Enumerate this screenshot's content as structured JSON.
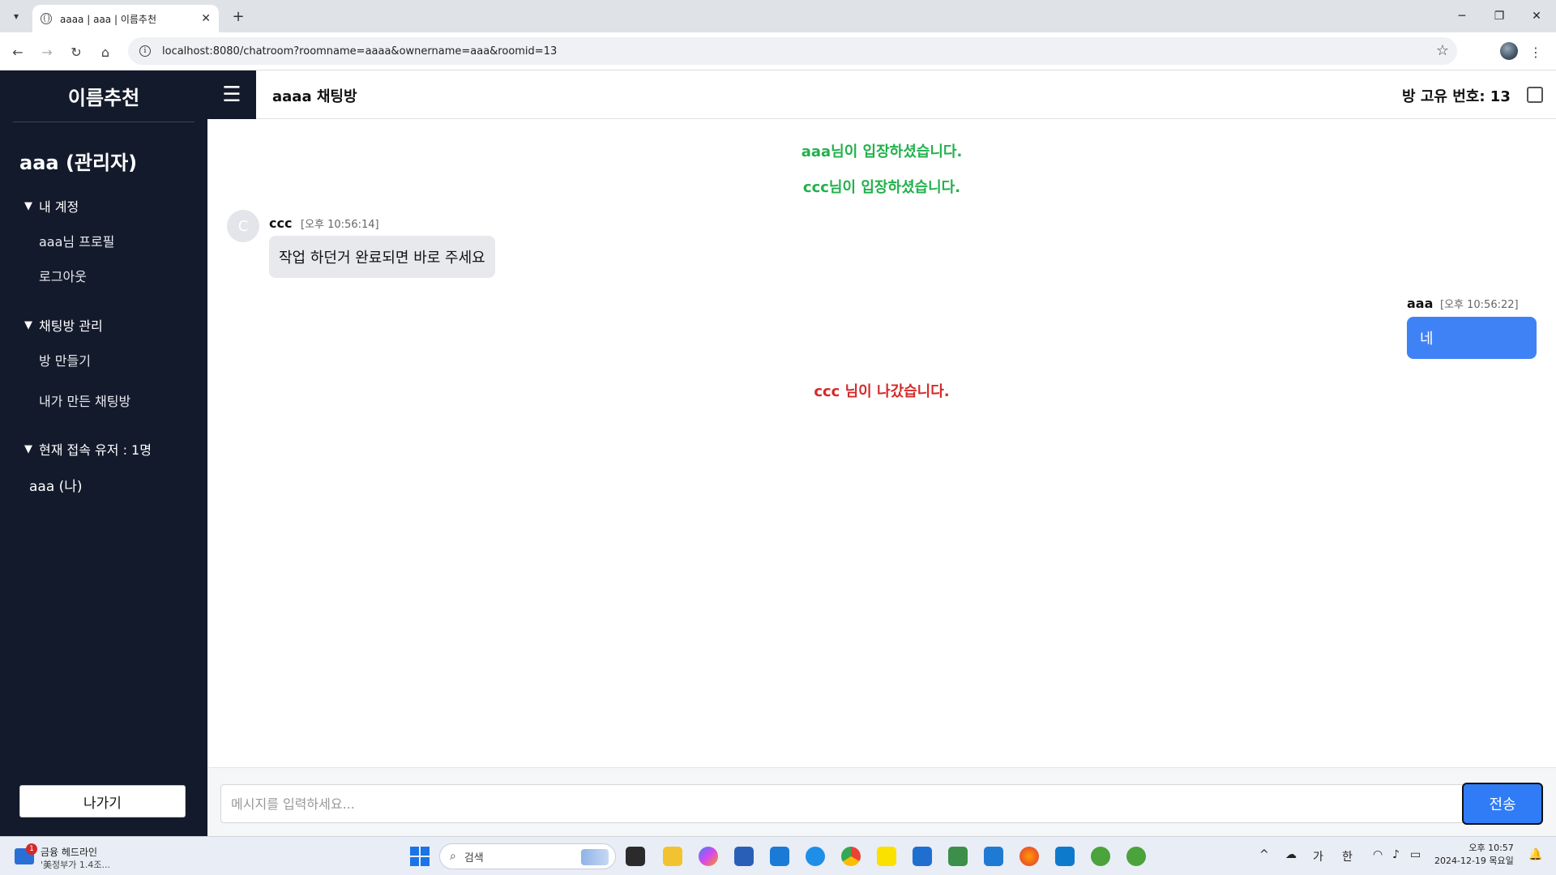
{
  "browser": {
    "tab_title": "aaaa | aaa | 이름추천",
    "tab_close": "✕",
    "new_tab": "+",
    "url": "localhost:8080/chatroom?roomname=aaaa&ownername=aaa&roomid=13",
    "win_min": "─",
    "win_restore": "❐",
    "win_close": "✕"
  },
  "sidebar": {
    "brand": "이름추천",
    "user_title": "aaa (관리자)",
    "sections": [
      {
        "label": "내 계정",
        "items": [
          "aaa님 프로필",
          "로그아웃"
        ]
      },
      {
        "label": "채팅방 관리",
        "items": [
          "방 만들기",
          "내가 만든 채팅방"
        ]
      },
      {
        "label": "현재 접속 유저 : 1명",
        "items": []
      }
    ],
    "online_user": "aaa (나)",
    "leave_button": "나가기"
  },
  "topbar": {
    "menu_icon": "☰",
    "room_title": "aaaa 채팅방",
    "room_id": "방 고유 번호: 13"
  },
  "chat": {
    "system_join_1": "aaa님이 입장하셨습니다.",
    "system_join_2": "ccc님이 입장하셨습니다.",
    "message_1": {
      "avatar": "C",
      "name": "ccc",
      "time": "[오후 10:56:14]",
      "text": "작업 하던거 완료되면 바로 주세요"
    },
    "message_2": {
      "name": "aaa",
      "time": "[오후 10:56:22]",
      "text": "네"
    },
    "system_leave": "ccc 님이 나갔습니다."
  },
  "composer": {
    "placeholder": "메시지를 입력하세요...",
    "send_button": "전송"
  },
  "taskbar": {
    "news_badge": "1",
    "news_title": "금융 헤드라인",
    "news_sub": "'美정부가 1.4조...",
    "search_text": "검색",
    "tray_chevron": "^",
    "ime_1": "가",
    "ime_2": "한",
    "time": "오후 10:57",
    "date": "2024-12-19 목요일"
  },
  "colors": {
    "sidebar_bg": "#131a2b",
    "system_green": "#22b14c",
    "system_red": "#d42a2a",
    "my_bubble": "#3f82f5",
    "send_button": "#2f7cf6"
  }
}
